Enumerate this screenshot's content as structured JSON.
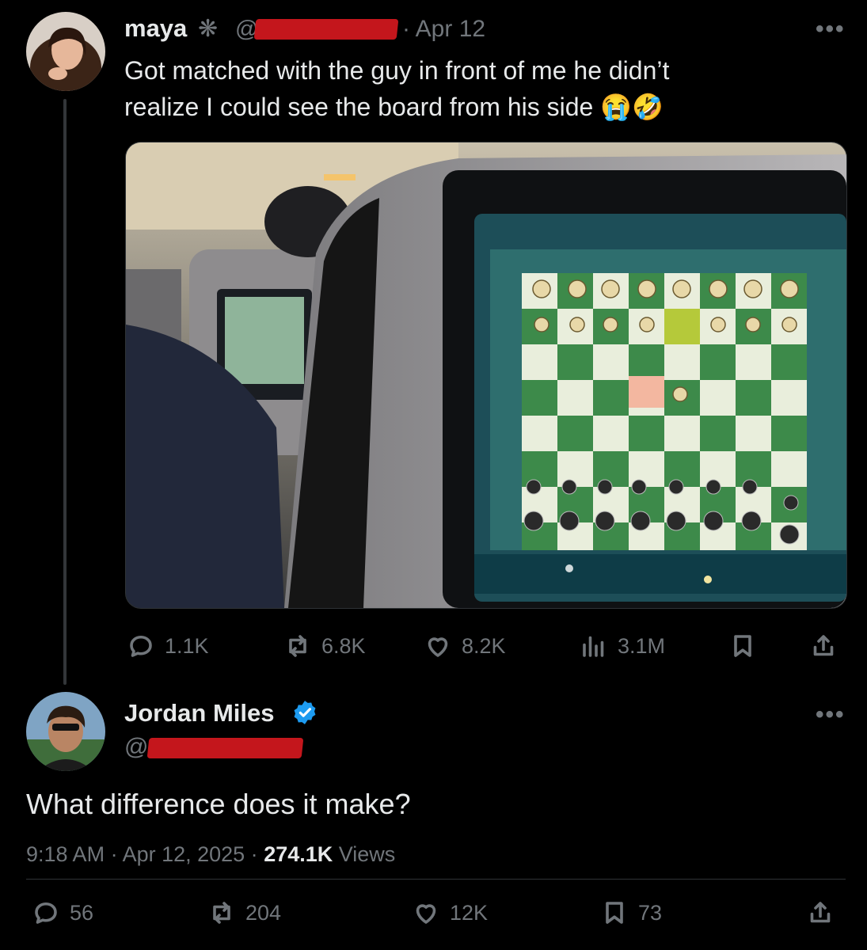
{
  "tweet": {
    "author_name": "maya",
    "name_glyph": "❋",
    "handle_prefix": "@",
    "date": "· Apr 12",
    "text_line1": "Got matched with the guy in front of me he didn’t",
    "text_line2": "realize I could see the board from his side",
    "emojis": "😭🤣",
    "stats": {
      "replies": "1.1K",
      "reposts": "6.8K",
      "likes": "8.2K",
      "views": "3.1M"
    }
  },
  "reply": {
    "author_name": "Jordan Miles",
    "handle_prefix": "@",
    "text": "What difference does it make?",
    "time": "9:18 AM · Apr 12, 2025 · ",
    "view_count": "274.1K",
    "views_label": " Views",
    "stats": {
      "replies": "56",
      "reposts": "204",
      "likes": "12K",
      "bookmarks": "73"
    }
  },
  "menu_glyph": "•••",
  "icons": [
    "reply-icon",
    "repost-icon",
    "like-icon",
    "views-icon",
    "bookmark-icon",
    "share-icon",
    "verified-badge-icon",
    "more-icon"
  ],
  "colors": {
    "background": "#000000",
    "text": "#e7e9ea",
    "muted": "#71767b",
    "verified": "#1d9bf0",
    "redaction": "#c4161c"
  }
}
